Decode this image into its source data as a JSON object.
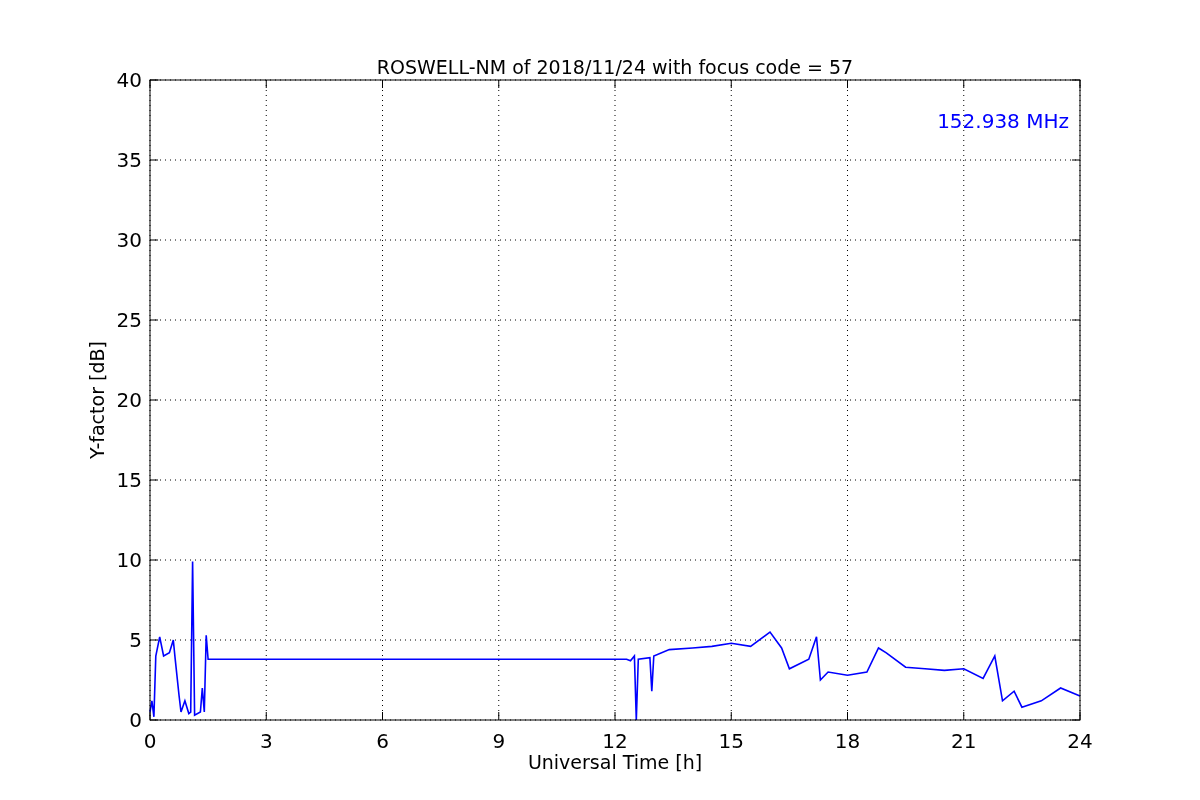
{
  "chart_data": {
    "type": "line",
    "title": "ROSWELL-NM of 2018/11/24 with focus code = 57",
    "xlabel": "Universal Time [h]",
    "ylabel": "Y-factor [dB]",
    "x": [
      0,
      0.05,
      0.1,
      0.15,
      0.25,
      0.35,
      0.5,
      0.6,
      0.65,
      0.75,
      0.8,
      0.9,
      1.0,
      1.05,
      1.1,
      1.15,
      1.3,
      1.35,
      1.4,
      1.45,
      1.5,
      12.3,
      12.4,
      12.5,
      12.55,
      12.6,
      12.9,
      12.95,
      13.0,
      13.4,
      14,
      14.5,
      15,
      15.5,
      16,
      16.3,
      16.5,
      17,
      17.2,
      17.3,
      17.5,
      18,
      18.5,
      18.8,
      19,
      19.5,
      20,
      20.5,
      21,
      21.5,
      21.8,
      22,
      22.3,
      22.5,
      23,
      23.5,
      24
    ],
    "series": [
      {
        "color": "#0000ff",
        "values": [
          0.5,
          1.2,
          0.2,
          4,
          5.2,
          4,
          4.2,
          5,
          3.8,
          1.5,
          0.5,
          1.2,
          0.4,
          0.5,
          9.9,
          0.3,
          0.5,
          2,
          0.5,
          5.3,
          3.8,
          3.8,
          3.7,
          4,
          0,
          3.8,
          3.9,
          1.8,
          4,
          4.4,
          4.5,
          4.6,
          4.8,
          4.6,
          5.5,
          4.5,
          3.2,
          3.8,
          5.2,
          2.5,
          3,
          2.8,
          3,
          4.5,
          4.2,
          3.3,
          3.2,
          3.1,
          3.2,
          2.6,
          4,
          1.2,
          1.8,
          0.8,
          1.2,
          2,
          1.5
        ]
      }
    ],
    "xlim": [
      0,
      24
    ],
    "ylim": [
      0,
      40
    ],
    "xticks": [
      0,
      3,
      6,
      9,
      12,
      15,
      18,
      21,
      24
    ],
    "yticks": [
      0,
      5,
      10,
      15,
      20,
      25,
      30,
      35,
      40
    ],
    "grid": true,
    "annotations": [
      {
        "text": "152.938 MHz"
      }
    ]
  }
}
